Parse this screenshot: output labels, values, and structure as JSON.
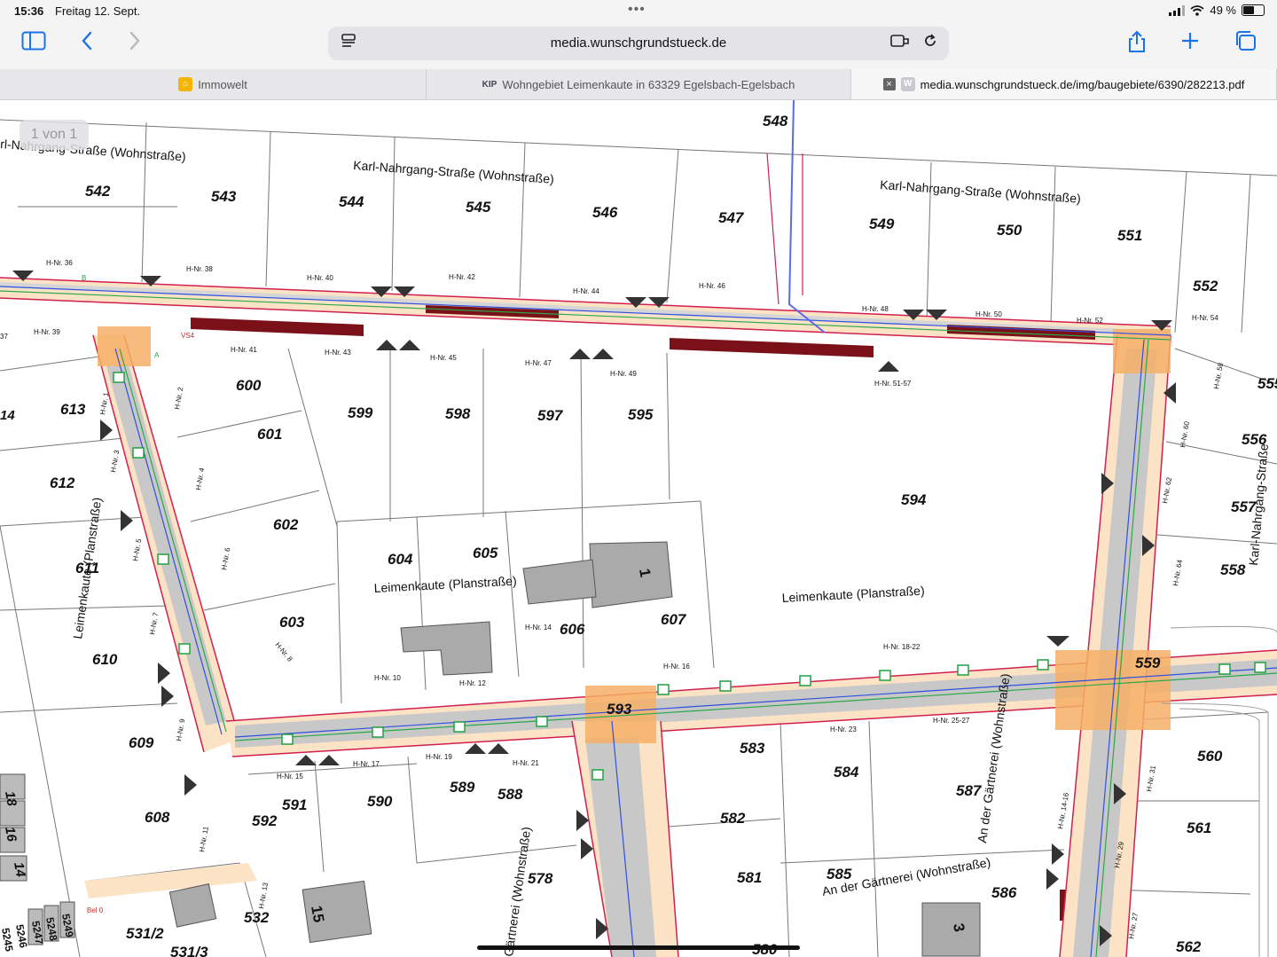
{
  "status": {
    "time": "15:36",
    "date": "Freitag 12. Sept.",
    "battery": "49 %",
    "battery_level": 0.49
  },
  "toolbar": {
    "url": "media.wunschgrundstueck.de"
  },
  "tabs": [
    {
      "label": "Immowelt",
      "favicon": "immowelt-favicon"
    },
    {
      "label": "Wohngebiet Leimenkaute in 63329 Egelsbach-Egelsbach",
      "favicon_text": "KIP"
    },
    {
      "label": "media.wunschgrundstueck.de/img/baugebiete/6390/282213.pdf",
      "favicon_text": "W"
    }
  ],
  "pdf": {
    "page_indicator": "1 von 1"
  },
  "map": {
    "plots": [
      "542",
      "543",
      "544",
      "545",
      "546",
      "547",
      "548",
      "549",
      "550",
      "551",
      "552",
      "555",
      "556",
      "557",
      "558",
      "559",
      "560",
      "561",
      "562",
      "613",
      "612",
      "611",
      "610",
      "609",
      "608",
      "600",
      "601",
      "602",
      "603",
      "599",
      "598",
      "597",
      "595",
      "594",
      "604",
      "605",
      "606",
      "607",
      "592",
      "591",
      "590",
      "589",
      "588",
      "593",
      "583",
      "584",
      "582",
      "581",
      "578",
      "587",
      "586",
      "585",
      "580",
      "532",
      "531/2",
      "531/3",
      "1",
      "3",
      "15"
    ],
    "streets": [
      "Karl-Nahrgang-Straße (Wohnstraße)",
      "Karl-Nahrgang-Straße (Wohnstraße)",
      "rl-Nahrgang-Straße (Wohnstraße)",
      "Leimenkaute (Planstraße)",
      "Leimenkaute (Planstraße)",
      "Leimenkaute (Planstraße)",
      "Karl-Nahrgang-Straße",
      "An der Gärtnerei (Wohnstraße)",
      "An der Gärtnerei (Wohnstraße)",
      "Gärtnerei (Wohnstraße)"
    ],
    "house_numbers": [
      "H-Nr. 36",
      "H-Nr. 38",
      "H-Nr. 40",
      "H-Nr. 42",
      "H-Nr. 44",
      "H-Nr. 46",
      "H-Nr. 48",
      "H-Nr. 50",
      "H-Nr. 52",
      "H-Nr. 54",
      "H-Nr. 39",
      "H-Nr. 41",
      "H-Nr. 43",
      "H-Nr. 45",
      "H-Nr. 47",
      "H-Nr. 49",
      "H-Nr. 51-57",
      "H-Nr. 1",
      "H-Nr. 2",
      "H-Nr. 3",
      "H-Nr. 4",
      "H-Nr. 5",
      "H-Nr. 6",
      "H-Nr. 7",
      "H-Nr. 8",
      "H-Nr. 9",
      "H-Nr. 10",
      "H-Nr. 11",
      "H-Nr. 12",
      "H-Nr. 13",
      "H-Nr. 14",
      "H-Nr. 15",
      "H-Nr. 16",
      "H-Nr. 17",
      "H-Nr. 18-22",
      "H-Nr. 19",
      "H-Nr. 21",
      "H-Nr. 23",
      "H-Nr. 25-27",
      "H-Nr. 58",
      "H-Nr. 60",
      "H-Nr. 62",
      "H-Nr. 64",
      "H-Nr. 31",
      "H-Nr. 29",
      "H-Nr. 27",
      "H-Nr. 14-16"
    ],
    "edge_numbers": [
      "14",
      "18",
      "16",
      "14",
      "5249",
      "5248",
      "5247",
      "5246",
      "5245",
      "37",
      "Bel 0",
      "VS4",
      "B",
      "A"
    ]
  }
}
